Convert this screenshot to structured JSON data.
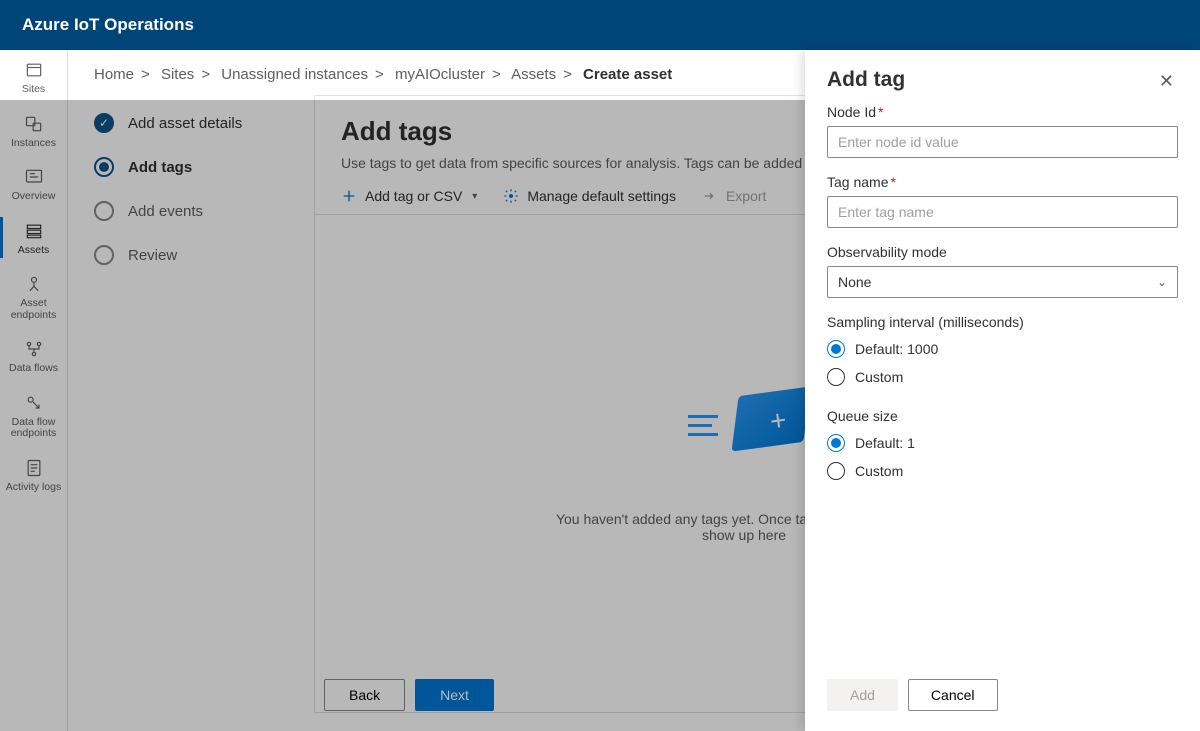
{
  "header": {
    "title": "Azure IoT Operations"
  },
  "rail": {
    "items": [
      {
        "id": "sites",
        "label": "Sites"
      },
      {
        "id": "instances",
        "label": "Instances"
      },
      {
        "id": "overview",
        "label": "Overview"
      },
      {
        "id": "assets",
        "label": "Assets",
        "selected": true
      },
      {
        "id": "asset-endpoints",
        "label": "Asset endpoints"
      },
      {
        "id": "data-flows",
        "label": "Data flows"
      },
      {
        "id": "data-flow-endpoints",
        "label": "Data flow endpoints"
      },
      {
        "id": "activity-logs",
        "label": "Activity logs"
      }
    ]
  },
  "breadcrumb": {
    "items": [
      "Home",
      "Sites",
      "Unassigned instances",
      "myAIOcluster",
      "Assets"
    ],
    "current": "Create asset"
  },
  "wizard": {
    "steps": [
      {
        "label": "Add asset details",
        "state": "done"
      },
      {
        "label": "Add tags",
        "state": "active"
      },
      {
        "label": "Add events",
        "state": "pending"
      },
      {
        "label": "Review",
        "state": "pending"
      }
    ]
  },
  "panel": {
    "title": "Add tags",
    "subtitle": "Use tags to get data from specific sources for analysis. Tags can be added manually or from a data source.",
    "toolbar": {
      "addTag": "Add tag or CSV",
      "manage": "Manage default settings",
      "export": "Export"
    },
    "empty": {
      "line1": "You haven't added any tags yet. Once tags are added, they'll",
      "line2": "show up here"
    },
    "back": "Back",
    "next": "Next"
  },
  "sidePanel": {
    "title": "Add tag",
    "nodeId": {
      "label": "Node Id",
      "placeholder": "Enter node id value",
      "value": ""
    },
    "tagName": {
      "label": "Tag name",
      "placeholder": "Enter tag name",
      "value": ""
    },
    "observability": {
      "label": "Observability mode",
      "value": "None"
    },
    "sampling": {
      "label": "Sampling interval (milliseconds)",
      "option1": "Default: 1000",
      "option2": "Custom",
      "selected": "default"
    },
    "queue": {
      "label": "Queue size",
      "option1": "Default: 1",
      "option2": "Custom",
      "selected": "default"
    },
    "add": "Add",
    "cancel": "Cancel"
  }
}
